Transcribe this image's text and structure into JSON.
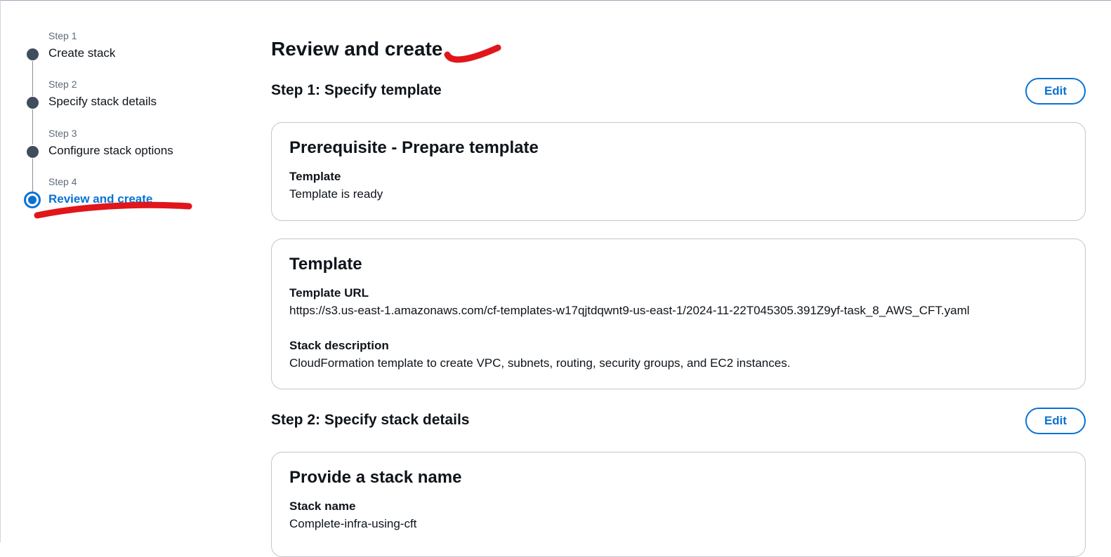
{
  "wizard": {
    "steps": [
      {
        "number": "Step 1",
        "label": "Create stack"
      },
      {
        "number": "Step 2",
        "label": "Specify stack details"
      },
      {
        "number": "Step 3",
        "label": "Configure stack options"
      },
      {
        "number": "Step 4",
        "label": "Review and create"
      }
    ],
    "active_step": 4
  },
  "page": {
    "title": "Review and create"
  },
  "step1": {
    "header": "Step 1: Specify template",
    "edit_label": "Edit",
    "prerequisite": {
      "title": "Prerequisite - Prepare template",
      "template_label": "Template",
      "template_value": "Template is ready"
    },
    "template": {
      "title": "Template",
      "url_label": "Template URL",
      "url_value": "https://s3.us-east-1.amazonaws.com/cf-templates-w17qjtdqwnt9-us-east-1/2024-11-22T045305.391Z9yf-task_8_AWS_CFT.yaml",
      "description_label": "Stack description",
      "description_value": "CloudFormation template to create VPC, subnets, routing, security groups, and EC2 instances."
    }
  },
  "step2": {
    "header": "Step 2: Specify stack details",
    "edit_label": "Edit",
    "stack_name_card": {
      "title": "Provide a stack name",
      "name_label": "Stack name",
      "name_value": "Complete-infra-using-cft"
    }
  },
  "colors": {
    "accent": "#0972d3",
    "step_dot": "#414d5c",
    "annotation": "#e0161b"
  }
}
